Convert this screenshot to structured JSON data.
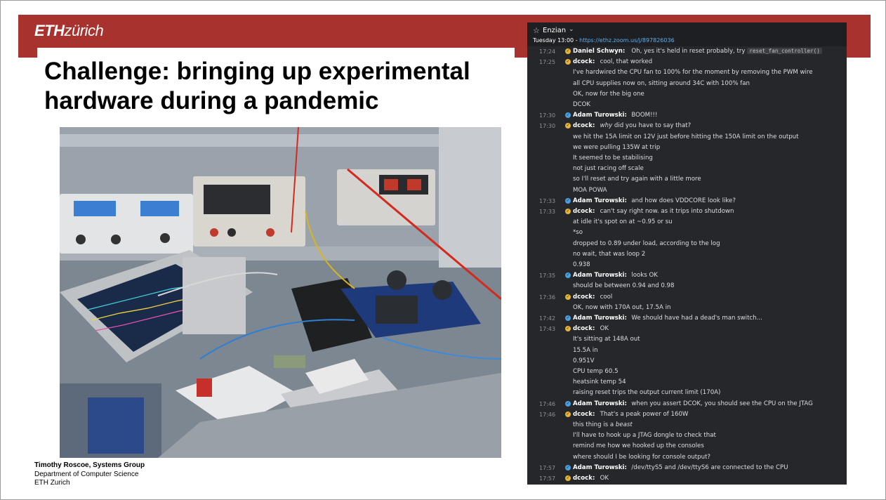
{
  "header": {
    "logo_eth": "ETH",
    "logo_zurich": "zürich",
    "title_line1": "Challenge: bringing up experimental",
    "title_line2": "hardware during a pandemic",
    "colors": {
      "bar": "#a8322d"
    }
  },
  "footer": {
    "name": "Timothy Roscoe, Systems Group",
    "dept": "Department of Computer Science",
    "inst": "ETH Zurich"
  },
  "chat": {
    "channel": "Enzian",
    "meeting_time": "Tuesday 13:00 - ",
    "meeting_link": "https://ethz.zoom.us/j/897826036",
    "messages": [
      {
        "time": "17:24",
        "user": "Daniel Schwyn:",
        "text": "Oh, yes it's held in reset probably, try ",
        "code": "reset_fan_controller()",
        "icon": "y"
      },
      {
        "time": "17:25",
        "user": "dcock:",
        "text": "cool, that worked",
        "icon": "y"
      },
      {
        "time": "",
        "user": "",
        "text": "I've hardwired the CPU fan to 100% for the moment by removing the PWM wire"
      },
      {
        "time": "",
        "user": "",
        "text": "all CPU supplies now on, sitting around 34C with 100% fan"
      },
      {
        "time": "",
        "user": "",
        "text": "OK, now for the big one"
      },
      {
        "time": "",
        "user": "",
        "text": "DCOK"
      },
      {
        "time": "17:30",
        "user": "Adam Turowski:",
        "text": "BOOM!!!",
        "icon": "b"
      },
      {
        "time": "17:30",
        "user": "dcock:",
        "em": "why",
        "text": " did you have to say that?",
        "icon": "y"
      },
      {
        "time": "",
        "user": "",
        "text": "we hit the 15A limit on 12V just before hitting the 150A limit on the output"
      },
      {
        "time": "",
        "user": "",
        "text": "we were pulling 135W at trip"
      },
      {
        "time": "",
        "user": "",
        "text": "It seemed to be stabilising"
      },
      {
        "time": "",
        "user": "",
        "text": "not just racing off scale"
      },
      {
        "time": "",
        "user": "",
        "text": "so I'll reset and try again with a little more"
      },
      {
        "time": "",
        "user": "",
        "text": "MOA POWA"
      },
      {
        "time": "17:33",
        "user": "Adam Turowski:",
        "text": "and how does VDDCORE look like?",
        "icon": "b"
      },
      {
        "time": "17:33",
        "user": "dcock:",
        "text": "can't say right now. as it trips into shutdown",
        "icon": "y"
      },
      {
        "time": "",
        "user": "",
        "text": "at idle it's spot on at ~0.95 or su"
      },
      {
        "time": "",
        "user": "",
        "text": "*so"
      },
      {
        "time": "",
        "user": "",
        "text": "dropped to 0.89 under load, according to the log"
      },
      {
        "time": "",
        "user": "",
        "text": "no wait, that was loop 2"
      },
      {
        "time": "",
        "user": "",
        "text": "0.938"
      },
      {
        "time": "17:35",
        "user": "Adam Turowski:",
        "text": "looks OK",
        "icon": "b"
      },
      {
        "time": "",
        "user": "",
        "text": "should be between 0.94 and 0.98"
      },
      {
        "time": "17:36",
        "user": "dcock:",
        "text": "cool",
        "icon": "y"
      },
      {
        "time": "",
        "user": "",
        "text": "OK, now with 170A out, 17.5A in"
      },
      {
        "time": "17:42",
        "user": "Adam Turowski:",
        "text": "We should have had a dead's man switch...",
        "icon": "b"
      },
      {
        "time": "17:43",
        "user": "dcock:",
        "text": "OK",
        "icon": "y"
      },
      {
        "time": "",
        "user": "",
        "text": "It's sitting at 148A out"
      },
      {
        "time": "",
        "user": "",
        "text": "15.5A in"
      },
      {
        "time": "",
        "user": "",
        "text": "0.951V"
      },
      {
        "time": "",
        "user": "",
        "text": "CPU temp 60.5"
      },
      {
        "time": "",
        "user": "",
        "text": "heatsink temp 54"
      },
      {
        "time": "",
        "user": "",
        "text": "raising reset trips the output current limit (170A)"
      },
      {
        "time": "17:46",
        "user": "Adam Turowski:",
        "text": "when you assert DCOK, you should see the CPU on the JTAG",
        "icon": "b"
      },
      {
        "time": "17:46",
        "user": "dcock:",
        "text": "That's a peak power of 160W",
        "icon": "y"
      },
      {
        "time": "",
        "user": "",
        "text": "this thing is a ",
        "em2": "beast"
      },
      {
        "time": "",
        "user": "",
        "text": "I'll have to hook up a JTAG dongle to check that"
      },
      {
        "time": "",
        "user": "",
        "text": "remind me how we hooked up the consoles"
      },
      {
        "time": "",
        "user": "",
        "text": "where should I be looking for console output?"
      },
      {
        "time": "17:57",
        "user": "Adam Turowski:",
        "text": "/dev/ttyS5 and /dev/ttyS6 are connected to the CPU",
        "icon": "b"
      },
      {
        "time": "17:57",
        "user": "dcock:",
        "text": "OK",
        "icon": "y"
      }
    ]
  }
}
